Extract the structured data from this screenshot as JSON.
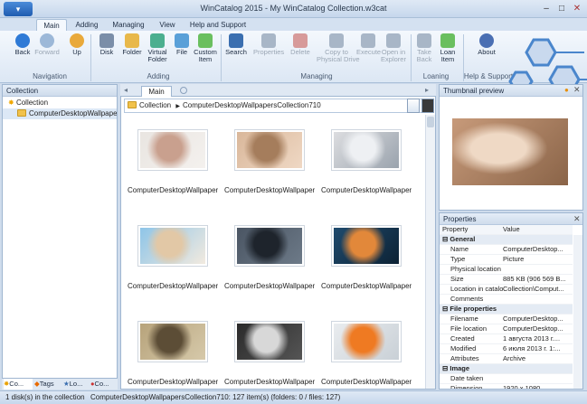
{
  "app": {
    "title": "WinCatalog 2015 - My WinCatalog Collection.w3cat",
    "menu_button": "▾"
  },
  "ribbon_tabs": [
    "Main",
    "Adding",
    "Managing",
    "View",
    "Help and Support"
  ],
  "ribbon": {
    "buttons": [
      {
        "label": "Back",
        "icon": "back-arrow-icon",
        "color": "#2f7ad6"
      },
      {
        "label": "Forward",
        "icon": "forward-arrow-icon",
        "color": "#9cb8d8"
      },
      {
        "label": "Up",
        "icon": "up-folder-icon",
        "color": "#e9a93a"
      },
      {
        "label": "Disk",
        "icon": "disk-icon",
        "color": "#7b8ea8"
      },
      {
        "label": "Folder",
        "icon": "add-folder-icon",
        "color": "#e8b84a"
      },
      {
        "label": "Virtual\nFolder",
        "icon": "virtual-folder-icon",
        "color": "#4caf8f"
      },
      {
        "label": "File",
        "icon": "add-file-icon",
        "color": "#5aa0d8"
      },
      {
        "label": "Custom\nItem",
        "icon": "custom-item-icon",
        "color": "#6abf5f"
      },
      {
        "label": "Search",
        "icon": "search-icon",
        "color": "#3b6fb0"
      },
      {
        "label": "Properties",
        "icon": "properties-icon",
        "color": "#a8b6c7"
      },
      {
        "label": "Delete",
        "icon": "delete-icon",
        "color": "#d79a9a"
      },
      {
        "label": "Copy to\nPhysical Drive",
        "icon": "copy-icon",
        "color": "#a8b6c7"
      },
      {
        "label": "Execute",
        "icon": "execute-icon",
        "color": "#a8b6c7"
      },
      {
        "label": "Open in\nExplorer",
        "icon": "open-explorer-icon",
        "color": "#a8b6c7"
      },
      {
        "label": "Take\nBack",
        "icon": "take-back-icon",
        "color": "#a8b6c7"
      },
      {
        "label": "Loan\nItem",
        "icon": "loan-item-icon",
        "color": "#6abf5f"
      },
      {
        "label": "About",
        "icon": "about-icon",
        "color": "#4a6fb3"
      }
    ],
    "groups": [
      "Navigation",
      "Adding",
      "Managing",
      "Loaning",
      "Help & Support"
    ]
  },
  "left_panel": {
    "header": "Collection",
    "tree": [
      "Collection",
      "ComputerDesktopWallpapersCollection710"
    ],
    "bottom_tabs": [
      "Co...",
      "Tags",
      "Lo...",
      "Co..."
    ]
  },
  "center": {
    "tabs": [
      "Main",
      ""
    ],
    "breadcrumb": [
      "Collection",
      "ComputerDesktopWallpapersCollection710"
    ],
    "thumbnails": [
      {
        "caption": "ComputerDesktopWallpaper...",
        "colors": [
          "#e9e5e1",
          "#c9a08e",
          "#f4f1ee"
        ]
      },
      {
        "caption": "ComputerDesktopWallpaper...",
        "colors": [
          "#d9b79a",
          "#a57d5c",
          "#efd8c4"
        ]
      },
      {
        "caption": "ComputerDesktopWallpaper...",
        "colors": [
          "#dcdde0",
          "#eef0f3",
          "#9aa3ad"
        ]
      },
      {
        "caption": "ComputerDesktopWallpaper...",
        "colors": [
          "#8ec5e8",
          "#e2c8a6",
          "#f2eadf"
        ]
      },
      {
        "caption": "ComputerDesktopWallpaper...",
        "colors": [
          "#4a5563",
          "#1e242c",
          "#6d7a88"
        ]
      },
      {
        "caption": "ComputerDesktopWallpaper...",
        "colors": [
          "#1f4b6e",
          "#e2883a",
          "#0d2234"
        ]
      },
      {
        "caption": "ComputerDesktopWallpaper...",
        "colors": [
          "#b7a37b",
          "#5c4d36",
          "#d6c9aa"
        ]
      },
      {
        "caption": "ComputerDesktopWallpaper...",
        "colors": [
          "#2a2a2a",
          "#d8d8d8",
          "#555555"
        ]
      },
      {
        "caption": "ComputerDesktopWallpaper...",
        "colors": [
          "#e9ecef",
          "#ef7a22",
          "#c9d0d6"
        ]
      }
    ]
  },
  "preview": {
    "header": "Thumbnail preview",
    "colors": [
      "#c79a7a",
      "#efd9c5",
      "#8a6448"
    ]
  },
  "properties": {
    "header": "Properties",
    "col_property": "Property",
    "col_value": "Value",
    "rows": [
      {
        "cat": "General"
      },
      {
        "k": "Name",
        "v": "ComputerDesktop..."
      },
      {
        "k": "Type",
        "v": "Picture"
      },
      {
        "k": "Physical location",
        "v": ""
      },
      {
        "k": "Size",
        "v": "885 KB (906 569 B..."
      },
      {
        "k": "Location in catalog",
        "v": "Collection\\Comput..."
      },
      {
        "k": "Comments",
        "v": ""
      },
      {
        "cat": "File properties"
      },
      {
        "k": "Filename",
        "v": "ComputerDesktop..."
      },
      {
        "k": "File location",
        "v": "ComputerDesktop..."
      },
      {
        "k": "Created",
        "v": "1 августа 2013 г...."
      },
      {
        "k": "Modified",
        "v": "6 июля 2013 г. 1:..."
      },
      {
        "k": "Attributes",
        "v": "Archive"
      },
      {
        "cat": "Image"
      },
      {
        "k": "Date taken",
        "v": ""
      },
      {
        "k": "Dimension",
        "v": "1920 x 1080"
      }
    ]
  },
  "status": {
    "left": "1 disk(s) in the collection",
    "right": "ComputerDesktopWallpapersCollection710: 127 item(s) (folders: 0 / files: 127)"
  }
}
